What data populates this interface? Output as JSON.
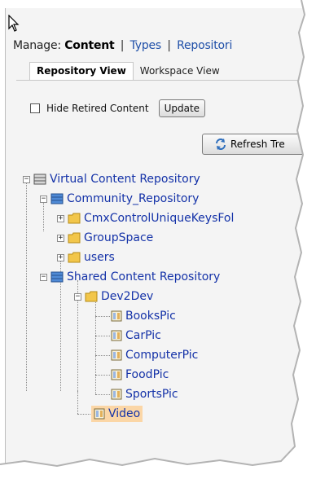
{
  "manage": {
    "prefix": "Manage:",
    "current": "Content",
    "links": [
      "Types",
      "Repositori"
    ],
    "separator": "|"
  },
  "tabs": {
    "repository_view": "Repository View",
    "workspace_view": "Workspace View"
  },
  "options": {
    "hide_retired_label": "Hide Retired Content",
    "update_label": "Update",
    "refresh_label": "Refresh Tre"
  },
  "tree": {
    "root": "Virtual Content Repository",
    "community": "Community_Repository",
    "cmx_folder": "CmxControlUniqueKeysFol",
    "groupspace": "GroupSpace",
    "users": "users",
    "shared": "Shared Content Repository",
    "dev2dev": "Dev2Dev",
    "bookspic": "BooksPic",
    "carpic": "CarPic",
    "computerpic": "ComputerPic",
    "foodpic": "FoodPic",
    "sportspic": "SportsPic",
    "video": "Video",
    "expand_plus": "+",
    "expand_minus": "−"
  },
  "colors": {
    "link_blue": "#1f4fa8",
    "tree_text": "#1432a8",
    "selection": "#fbd6a6",
    "folder": "#f2c64a"
  }
}
